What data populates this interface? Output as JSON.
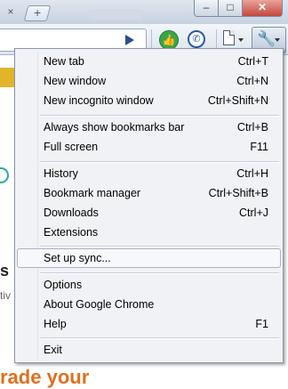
{
  "window": {
    "tab_close": "×",
    "new_tab_glyph": "+",
    "minimize": "–",
    "maximize": "□",
    "close": "✕"
  },
  "toolbar": {
    "icons": [
      "play-icon",
      "thumbs-up-icon",
      "call-icon",
      "page-icon",
      "wrench-icon"
    ]
  },
  "page_behind": {
    "heading_fragment": "s",
    "text_fragment": "tiv",
    "bottom_text": "rade your"
  },
  "menu": {
    "items": [
      {
        "label": "New tab",
        "shortcut": "Ctrl+T"
      },
      {
        "label": "New window",
        "shortcut": "Ctrl+N"
      },
      {
        "label": "New incognito window",
        "shortcut": "Ctrl+Shift+N"
      },
      {
        "label": "Always show bookmarks bar",
        "shortcut": "Ctrl+B"
      },
      {
        "label": "Full screen",
        "shortcut": "F11"
      },
      {
        "label": "History",
        "shortcut": "Ctrl+H"
      },
      {
        "label": "Bookmark manager",
        "shortcut": "Ctrl+Shift+B"
      },
      {
        "label": "Downloads",
        "shortcut": "Ctrl+J"
      },
      {
        "label": "Extensions",
        "shortcut": ""
      },
      {
        "label": "Set up sync...",
        "shortcut": ""
      },
      {
        "label": "Options",
        "shortcut": ""
      },
      {
        "label": "About Google Chrome",
        "shortcut": ""
      },
      {
        "label": "Help",
        "shortcut": "F1"
      },
      {
        "label": "Exit",
        "shortcut": ""
      }
    ],
    "hovered_item": "Set up sync..."
  }
}
